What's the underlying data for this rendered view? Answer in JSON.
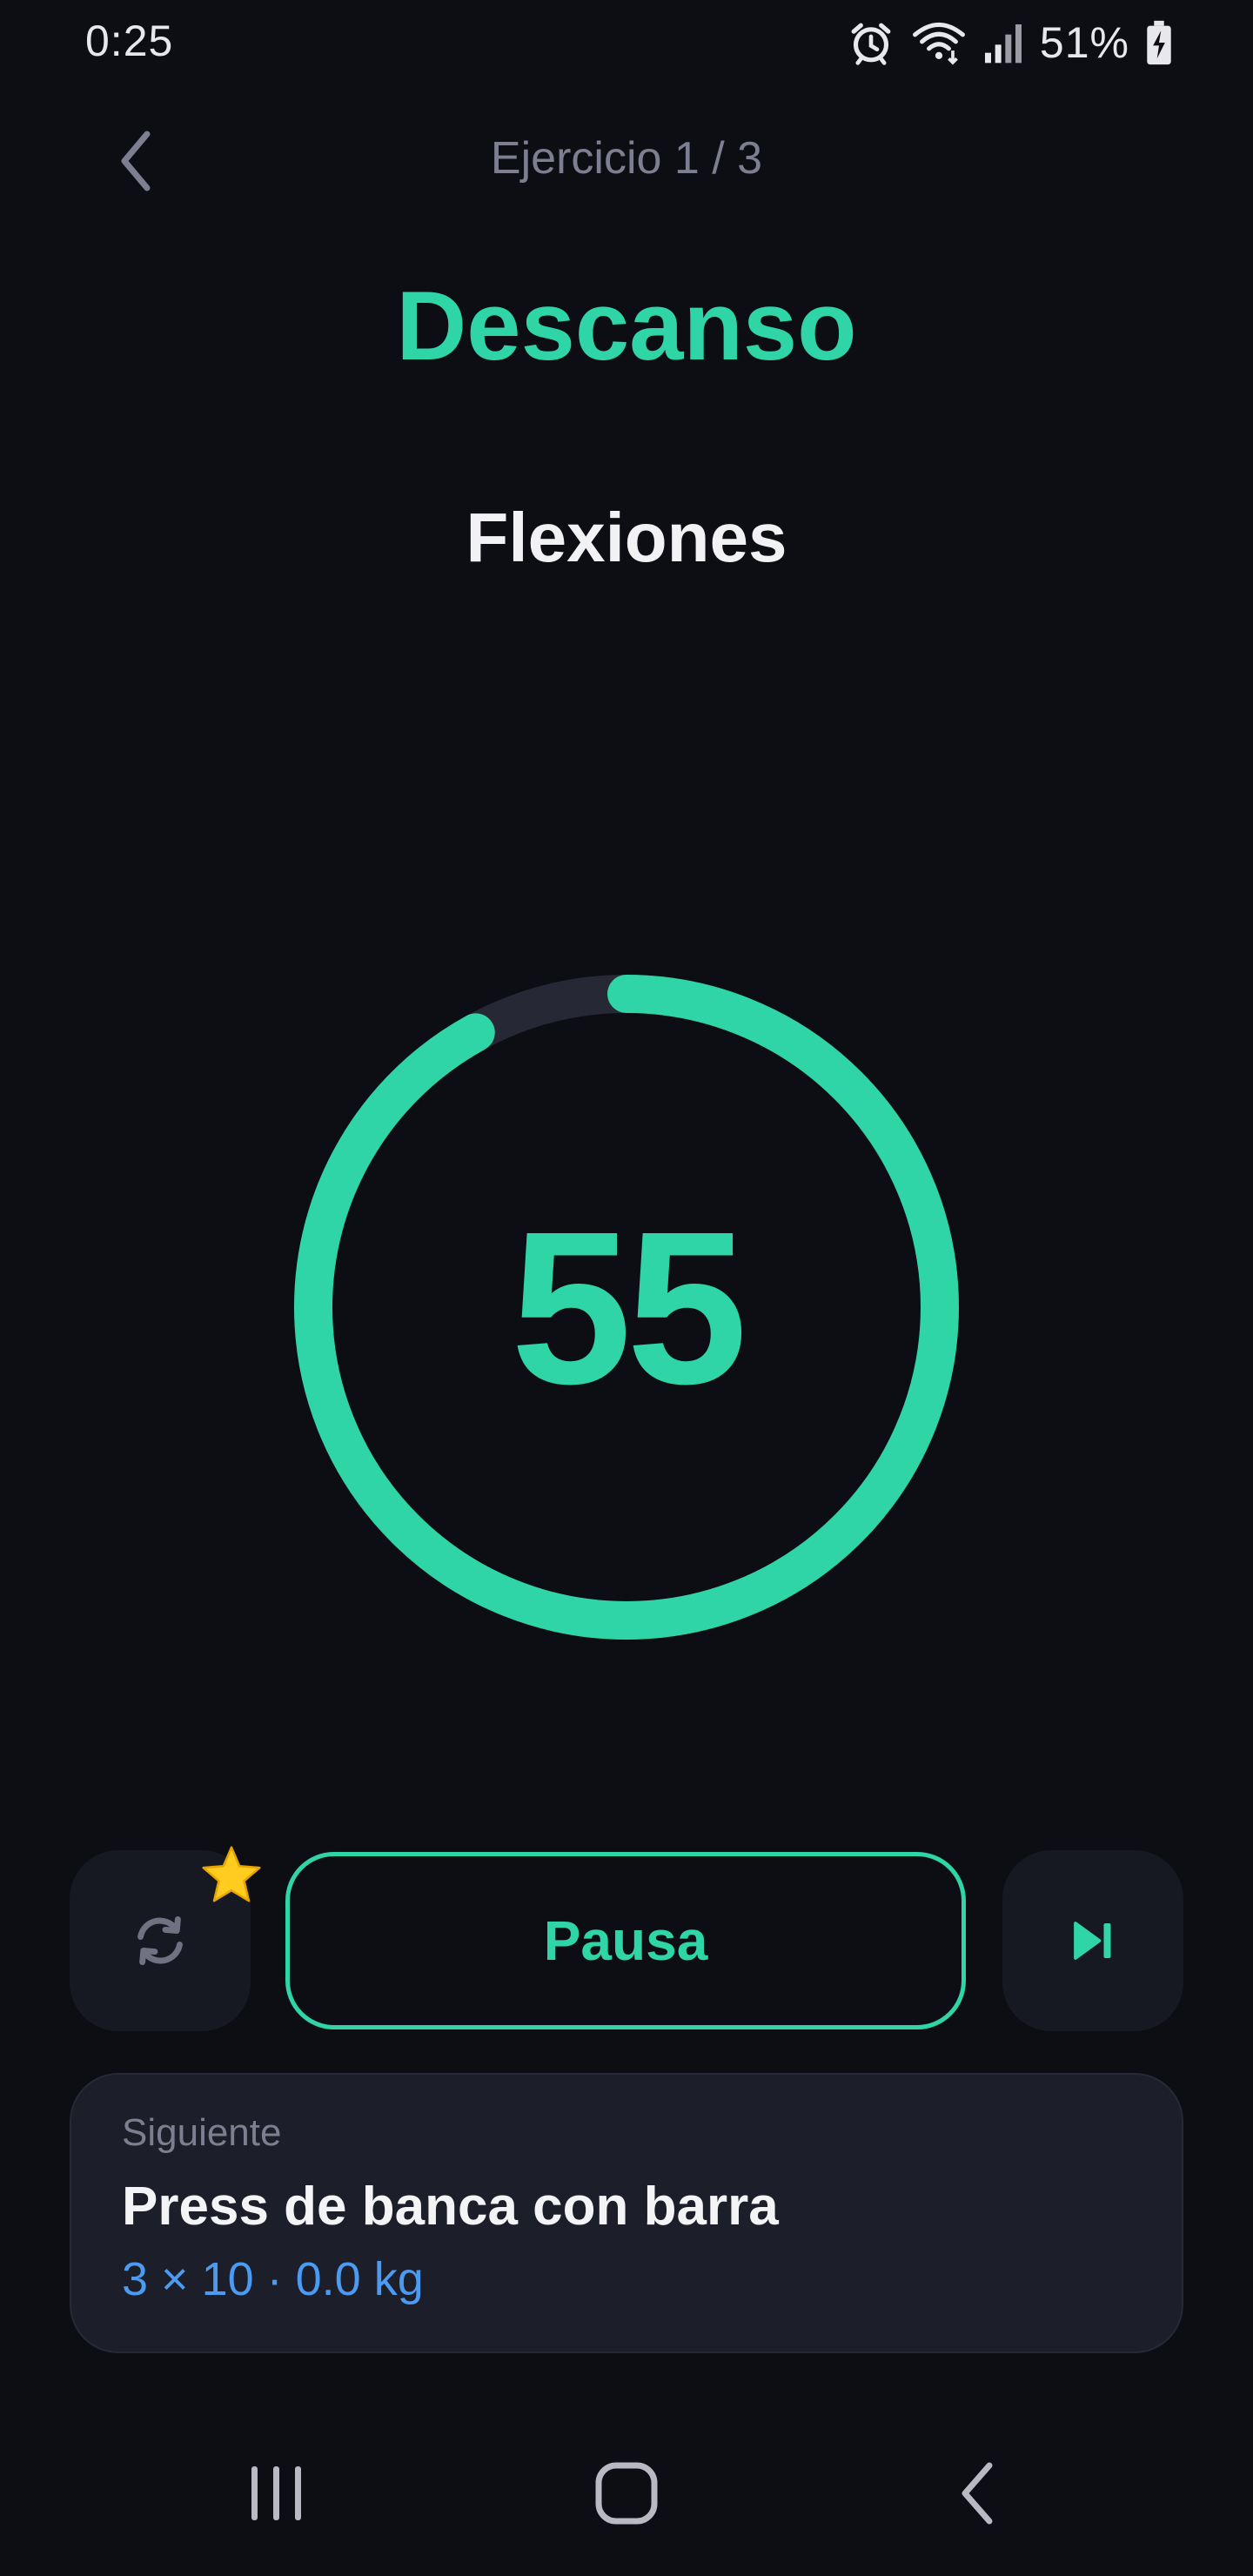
{
  "status_bar": {
    "time": "0:25",
    "battery": "51%",
    "icons": [
      "alarm-icon",
      "wifi-icon",
      "signal-icon",
      "battery-charging-icon"
    ]
  },
  "header": {
    "back_icon": "chevron-left-icon",
    "counter": "Ejercicio 1 / 3"
  },
  "phase": {
    "title": "Descanso",
    "exercise": "Flexiones"
  },
  "timer": {
    "value": "55",
    "progress_fraction": 0.92
  },
  "controls": {
    "restart_icon": "sync-icon",
    "badge_icon": "star-icon",
    "pause_label": "Pausa",
    "skip_icon": "skip-next-icon"
  },
  "next_up": {
    "label": "Siguiente",
    "name": "Press de banca con barra",
    "detail": "3 × 10 · 0.0 kg"
  },
  "nav": {
    "icons": [
      "recent-apps-icon",
      "home-icon",
      "back-icon"
    ]
  },
  "colors": {
    "accent": "#2fd5a6",
    "background": "#0c0e14",
    "card": "#1c1e29",
    "muted": "#7d7f91",
    "link": "#4b9bf2",
    "ring_track": "#262836"
  }
}
